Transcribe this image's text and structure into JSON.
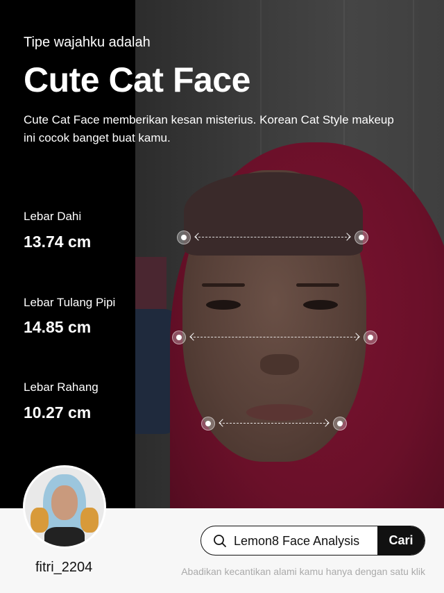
{
  "header": {
    "intro": "Tipe wajahku adalah",
    "title": "Cute Cat Face",
    "description": "Cute Cat Face memberikan kesan misterius. Korean Cat Style makeup ini cocok banget buat kamu."
  },
  "metrics": [
    {
      "label": "Lebar Dahi",
      "value": "13.74 cm"
    },
    {
      "label": "Lebar Tulang Pipi",
      "value": "14.85 cm"
    },
    {
      "label": "Lebar Rahang",
      "value": "10.27 cm"
    }
  ],
  "profile": {
    "username": "fitri_2204"
  },
  "search": {
    "query": "Lemon8 Face Analysis",
    "button_label": "Cari"
  },
  "footer": {
    "tagline": "Abadikan kecantikan alami kamu hanya dengan satu klik"
  },
  "colors": {
    "panel": "#000000",
    "footer_bg": "#f7f7f7",
    "button": "#111111",
    "hijab": "#7a1330"
  },
  "icons": {
    "search": "search-icon"
  }
}
